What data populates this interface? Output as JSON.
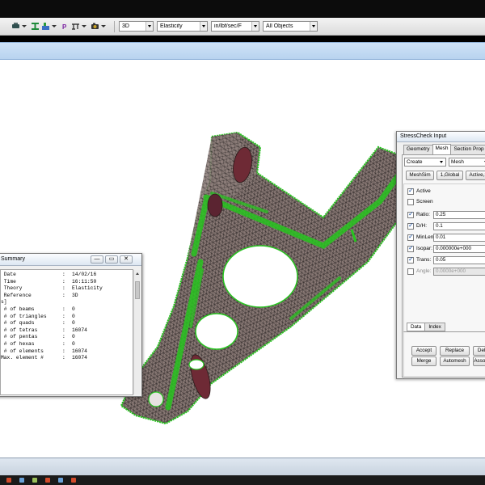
{
  "toolbar": {
    "icons": [
      "select-icon",
      "beam-icon",
      "node-icon",
      "point-icon",
      "tree-icon",
      "camera-icon"
    ],
    "view_mode": "3D",
    "analysis": "Elasticity",
    "units": "in/lbf/sec/F",
    "filter": "All Objects"
  },
  "summary": {
    "title": "Summary",
    "buttons": {
      "minimize": "—",
      "maximize": "▭",
      "close": "✕"
    },
    "lines": [
      {
        "key": "",
        "value": ""
      },
      {
        "key": " Date",
        "value": "14/02/16"
      },
      {
        "key": " Time",
        "value": "16:11:50"
      },
      {
        "key": " Theory",
        "value": "Elasticity"
      },
      {
        "key": " Reference",
        "value": "3D"
      },
      {
        "key": "",
        "value": ""
      },
      {
        "key": "s]",
        "value": "",
        "nocolon": true
      },
      {
        "key": " # of beams",
        "value": "0"
      },
      {
        "key": " # of triangles",
        "value": "0"
      },
      {
        "key": " # of quads",
        "value": "0"
      },
      {
        "key": " # of tetras",
        "value": "16074"
      },
      {
        "key": " # of pentas",
        "value": "0"
      },
      {
        "key": " # of hexas",
        "value": "0"
      },
      {
        "key": " # of elements",
        "value": "16074"
      },
      {
        "key": "Max. element #",
        "value": "16074"
      }
    ]
  },
  "stresscheck": {
    "title": "StressCheck Input",
    "tabs": [
      "Geometry",
      "Mesh",
      "Section Prop"
    ],
    "active_tab": "Mesh",
    "action": "Create",
    "object": "Mesh",
    "pills": [
      "MeshSim",
      "1,Global",
      "Active,S"
    ],
    "active_label": "Active",
    "screen_label": "Screen",
    "params": [
      {
        "label": "Ratio:",
        "value": "0.25",
        "checked": true,
        "enabled": true
      },
      {
        "label": "D/H:",
        "value": "0.1",
        "checked": true,
        "enabled": true
      },
      {
        "label": "MinLen:",
        "value": "0.01",
        "checked": true,
        "enabled": true
      },
      {
        "label": "Isopar:",
        "value": "0.000000e+000",
        "checked": true,
        "enabled": true
      },
      {
        "label": "Trans:",
        "value": "0.05",
        "checked": true,
        "enabled": true
      },
      {
        "label": "Angle:",
        "value": "0.0000e+000",
        "checked": false,
        "enabled": false
      }
    ],
    "subtabs": [
      "Data",
      "Index"
    ],
    "buttons_row1": [
      "Accept",
      "Replace",
      "Delete"
    ],
    "buttons_row2": [
      "Merge",
      "Automesh",
      "Associate"
    ]
  },
  "colors": {
    "mesh_fill": "#8a7a76",
    "mesh_edge": "#1b1b1b",
    "mesh_highlight": "#27c41f",
    "bore": "#6e2a35",
    "viewport_bg": "#ffffff"
  }
}
